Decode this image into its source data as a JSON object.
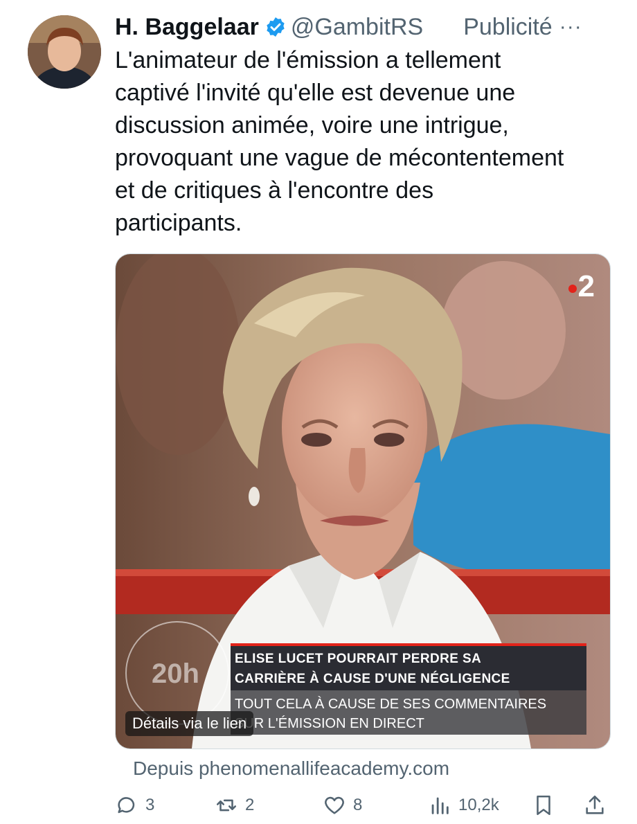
{
  "author": {
    "name": "H. Baggelaar",
    "handle": "@GambitRS",
    "ad_label": "Publicité",
    "more_icon": "more-icon",
    "verified_icon": "verified-badge-icon"
  },
  "tweet": {
    "text_lines": [
      "L'animateur de l'émission a tellement",
      "captivé l'invité qu'elle est devenue une",
      "discussion animée, voire une intrigue,",
      "provoquant une vague de mécontentement",
      "et de critiques à l'encontre des",
      "participants."
    ]
  },
  "media": {
    "channel_number": "2",
    "badge": "20h",
    "headline_line1": "ELISE LUCET POURRAIT PERDRE SA",
    "headline_line2": "CARRIÈRE À CAUSE D'UNE NÉGLIGENCE",
    "subline_line1": "TOUT CELA À CAUSE DE SES COMMENTAIRES",
    "subline_line2": "SUR L'ÉMISSION EN DIRECT",
    "details_label": "Détails via le lien",
    "accent_color": "#e2231a"
  },
  "source": "Depuis phenomenallifeacademy.com",
  "actions": {
    "replies": "3",
    "retweets": "2",
    "likes": "8",
    "views": "10,2k",
    "icons": [
      "reply-icon",
      "retweet-icon",
      "like-icon",
      "views-icon",
      "bookmark-icon",
      "share-icon"
    ]
  }
}
